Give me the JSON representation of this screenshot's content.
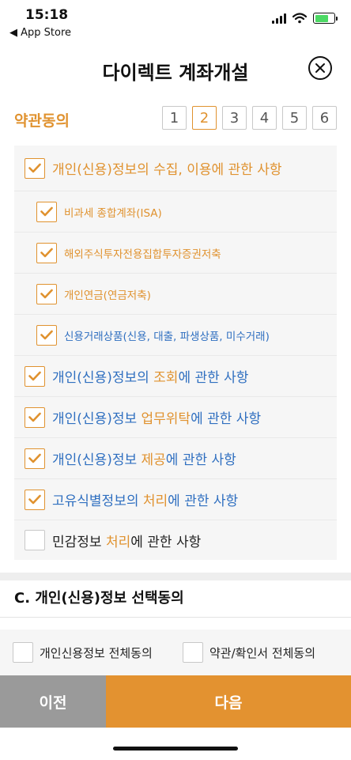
{
  "status_bar": {
    "time": "15:18",
    "back_label": "◀ App Store"
  },
  "header": {
    "title": "다이렉트 계좌개설"
  },
  "terms": {
    "section_label": "약관동의",
    "steps": [
      "1",
      "2",
      "3",
      "4",
      "5",
      "6"
    ],
    "active_step": "2"
  },
  "agreements": [
    {
      "level": 1,
      "checked": true,
      "parts": [
        {
          "t": "개인(신용)정보의 수집, 이용에 관한 사항",
          "c": "orange"
        }
      ]
    },
    {
      "level": 2,
      "checked": true,
      "parts": [
        {
          "t": "비과세 종합계좌(ISA)",
          "c": "orange"
        }
      ]
    },
    {
      "level": 2,
      "checked": true,
      "parts": [
        {
          "t": "해외주식투자전용집합투자증권저축",
          "c": "orange"
        }
      ]
    },
    {
      "level": 2,
      "checked": true,
      "parts": [
        {
          "t": "개인연금(연금저축)",
          "c": "orange"
        }
      ]
    },
    {
      "level": 2,
      "checked": true,
      "parts": [
        {
          "t": "신용거래상품(신용, 대출, 파생상품, 미수거래)",
          "c": "blue"
        }
      ]
    },
    {
      "level": 1,
      "checked": true,
      "parts": [
        {
          "t": "개인(신용)정보의 ",
          "c": "blue"
        },
        {
          "t": "조회",
          "c": "orange"
        },
        {
          "t": "에 관한 사항",
          "c": "blue"
        }
      ]
    },
    {
      "level": 1,
      "checked": true,
      "parts": [
        {
          "t": "개인(신용)정보 ",
          "c": "blue"
        },
        {
          "t": "업무위탁",
          "c": "orange"
        },
        {
          "t": "에 관한 사항",
          "c": "blue"
        }
      ]
    },
    {
      "level": 1,
      "checked": true,
      "parts": [
        {
          "t": "개인(신용)정보 ",
          "c": "blue"
        },
        {
          "t": "제공",
          "c": "orange"
        },
        {
          "t": "에 관한 사항",
          "c": "blue"
        }
      ]
    },
    {
      "level": 1,
      "checked": true,
      "parts": [
        {
          "t": "고유식별정보의 ",
          "c": "blue"
        },
        {
          "t": "처리",
          "c": "orange"
        },
        {
          "t": "에 관한 사항",
          "c": "blue"
        }
      ]
    },
    {
      "level": 1,
      "checked": false,
      "parts": [
        {
          "t": "민감정보 ",
          "c": "dark"
        },
        {
          "t": "처리",
          "c": "orange"
        },
        {
          "t": "에 관한 사항",
          "c": "dark"
        }
      ]
    }
  ],
  "section_c": {
    "title": "C. 개인(신용)정보 선택동의",
    "all_agree_personal": "개인신용정보 전체동의",
    "all_agree_terms": "약관/확인서 전체동의"
  },
  "buttons": {
    "prev": "이전",
    "next": "다음"
  },
  "colors": {
    "accent": "#e0922f",
    "link_blue": "#2f6fc0",
    "prev_gray": "#9a9a9a",
    "next_orange": "#e39230"
  }
}
